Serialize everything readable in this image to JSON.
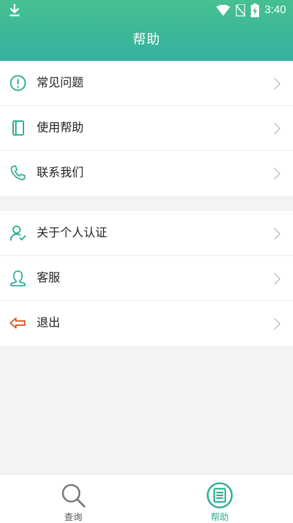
{
  "status": {
    "time": "3:40"
  },
  "header": {
    "title": "帮助"
  },
  "group1": {
    "items": [
      {
        "label": "常见问题",
        "icon": "exclamation-circle-icon"
      },
      {
        "label": "使用帮助",
        "icon": "book-icon"
      },
      {
        "label": "联系我们",
        "icon": "phone-icon"
      }
    ]
  },
  "group2": {
    "items": [
      {
        "label": "关于个人认证",
        "icon": "user-check-icon"
      },
      {
        "label": "客服",
        "icon": "customer-service-icon"
      },
      {
        "label": "退出",
        "icon": "logout-arrow-icon"
      }
    ]
  },
  "tabbar": {
    "tabs": [
      {
        "label": "查询",
        "icon": "search-icon",
        "active": false
      },
      {
        "label": "帮助",
        "icon": "help-list-icon",
        "active": true
      }
    ]
  },
  "colors": {
    "header_gradient_top": "#46c08f",
    "header_gradient_bottom": "#36b1a0",
    "icon_green": "#2bae95",
    "logout_red": "#e05a2b",
    "active_tab": "#2bae95"
  }
}
